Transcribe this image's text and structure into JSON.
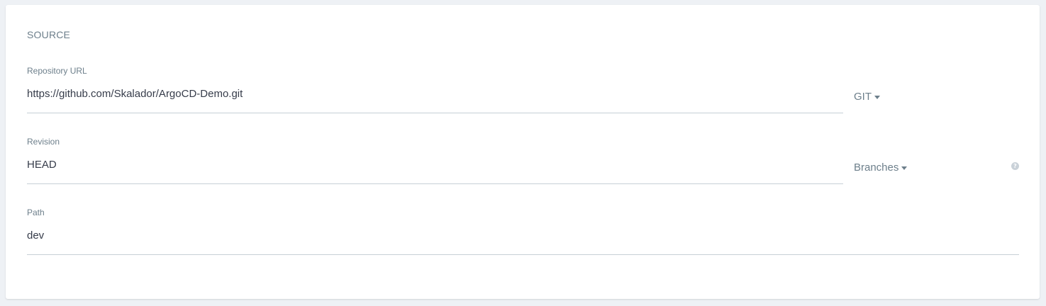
{
  "section": {
    "title": "SOURCE"
  },
  "repo": {
    "label": "Repository URL",
    "value": "https://github.com/Skalador/ArgoCD-Demo.git",
    "type_dropdown": "GIT"
  },
  "revision": {
    "label": "Revision",
    "value": "HEAD",
    "dropdown": "Branches",
    "help_icon": "question-circle-icon",
    "help_glyph": "?"
  },
  "path": {
    "label": "Path",
    "value": "dev"
  },
  "colors": {
    "label": "#6d7f8b",
    "text": "#363c4a",
    "underline": "#c6cfd6",
    "background": "#eef1f5",
    "panel": "#ffffff"
  }
}
